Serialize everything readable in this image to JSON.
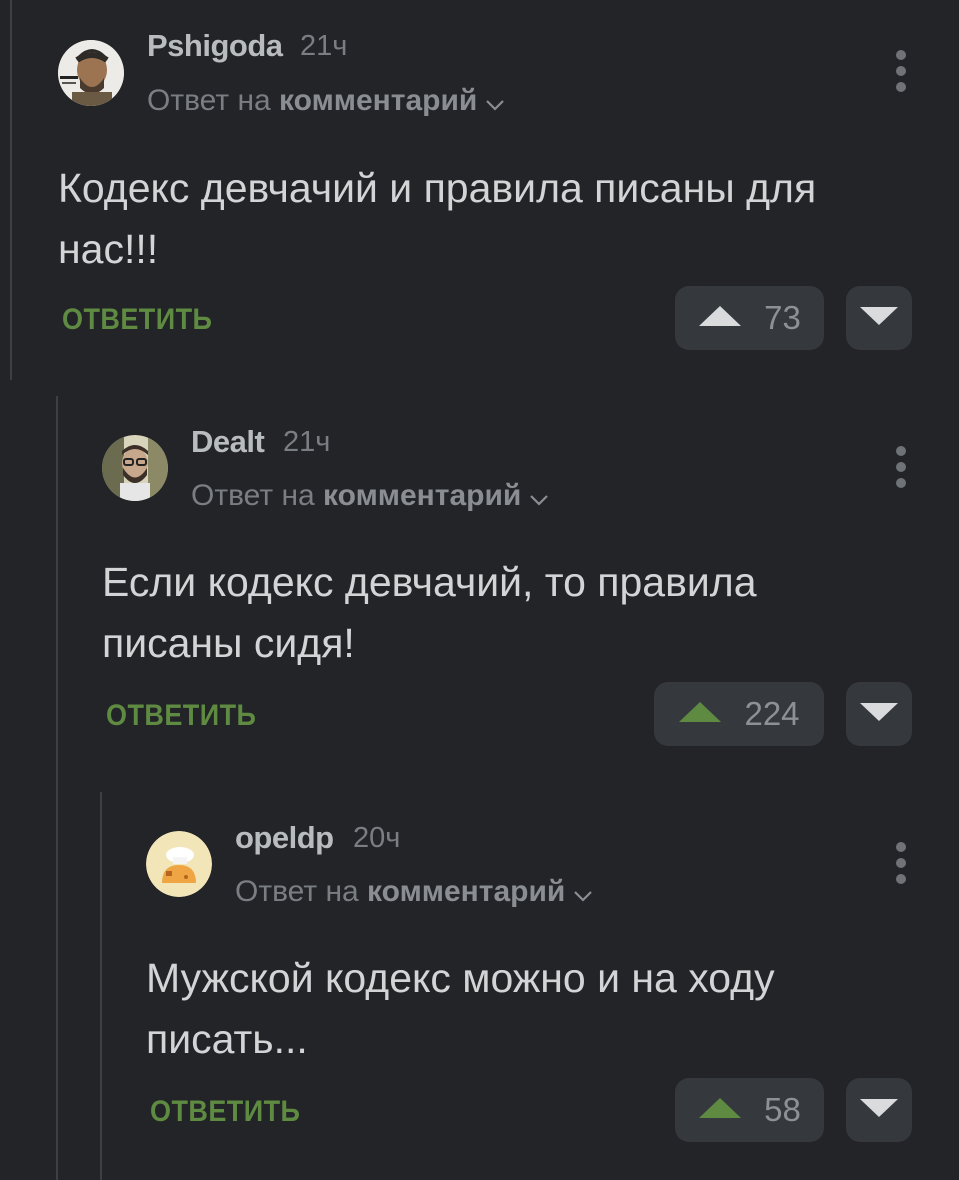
{
  "comments": [
    {
      "author": "Pshigoda",
      "time": "21ч",
      "reply_prefix": "Ответ на",
      "reply_target": "комментарий",
      "text": "Кодекс девчачий и правила писаны для нас!!!",
      "reply_label": "ОТВЕТИТЬ",
      "rating": "73",
      "upvoted": false
    },
    {
      "author": "Dealt",
      "time": "21ч",
      "reply_prefix": "Ответ на",
      "reply_target": "комментарий",
      "text": "Если кодекс девчачий, то правила писаны сидя!",
      "reply_label": "ОТВЕТИТЬ",
      "rating": "224",
      "upvoted": true
    },
    {
      "author": "opeldp",
      "time": "20ч",
      "reply_prefix": "Ответ на",
      "reply_target": "комментарий",
      "text": "Мужской кодекс можно и на ходу писать...",
      "reply_label": "ОТВЕТИТЬ",
      "rating": "58",
      "upvoted": true
    }
  ],
  "colors": {
    "background": "#222427",
    "accent_green": "#5f8a42",
    "button_bg": "#35383d",
    "arrow_inactive": "#d9dbdd"
  },
  "icons": [
    "upvote-arrow-icon",
    "downvote-arrow-icon",
    "kebab-menu-icon",
    "chevron-down-icon"
  ]
}
